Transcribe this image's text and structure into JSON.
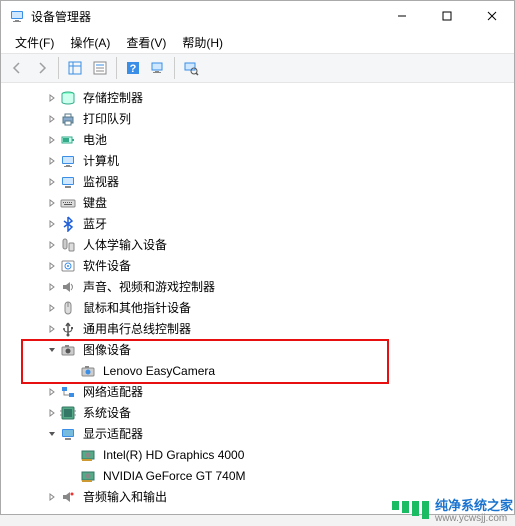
{
  "window": {
    "title": "设备管理器"
  },
  "menu": {
    "file": "文件(F)",
    "action": "操作(A)",
    "view": "查看(V)",
    "help": "帮助(H)"
  },
  "tree": {
    "items": [
      {
        "label": "存储控制器",
        "indent": 2,
        "exp": "right",
        "icon": "storage"
      },
      {
        "label": "打印队列",
        "indent": 2,
        "exp": "right",
        "icon": "printer"
      },
      {
        "label": "电池",
        "indent": 2,
        "exp": "right",
        "icon": "battery"
      },
      {
        "label": "计算机",
        "indent": 2,
        "exp": "right",
        "icon": "computer"
      },
      {
        "label": "监视器",
        "indent": 2,
        "exp": "right",
        "icon": "monitor"
      },
      {
        "label": "键盘",
        "indent": 2,
        "exp": "right",
        "icon": "keyboard"
      },
      {
        "label": "蓝牙",
        "indent": 2,
        "exp": "right",
        "icon": "bluetooth"
      },
      {
        "label": "人体学输入设备",
        "indent": 2,
        "exp": "right",
        "icon": "hid"
      },
      {
        "label": "软件设备",
        "indent": 2,
        "exp": "right",
        "icon": "software"
      },
      {
        "label": "声音、视频和游戏控制器",
        "indent": 2,
        "exp": "right",
        "icon": "sound"
      },
      {
        "label": "鼠标和其他指针设备",
        "indent": 2,
        "exp": "right",
        "icon": "mouse"
      },
      {
        "label": "通用串行总线控制器",
        "indent": 2,
        "exp": "right",
        "icon": "usb"
      },
      {
        "label": "图像设备",
        "indent": 2,
        "exp": "down",
        "icon": "imaging"
      },
      {
        "label": "Lenovo EasyCamera",
        "indent": 3,
        "exp": "none",
        "icon": "camera"
      },
      {
        "label": "网络适配器",
        "indent": 2,
        "exp": "right",
        "icon": "network"
      },
      {
        "label": "系统设备",
        "indent": 2,
        "exp": "right",
        "icon": "system"
      },
      {
        "label": "显示适配器",
        "indent": 2,
        "exp": "down",
        "icon": "display"
      },
      {
        "label": "Intel(R) HD Graphics 4000",
        "indent": 3,
        "exp": "none",
        "icon": "gpu"
      },
      {
        "label": "NVIDIA GeForce GT 740M",
        "indent": 3,
        "exp": "none",
        "icon": "gpu"
      },
      {
        "label": "音频输入和输出",
        "indent": 2,
        "exp": "right",
        "icon": "audio"
      }
    ]
  },
  "watermark": {
    "cn": "纯净系统之家",
    "url": "www.ycwsjj.com"
  }
}
